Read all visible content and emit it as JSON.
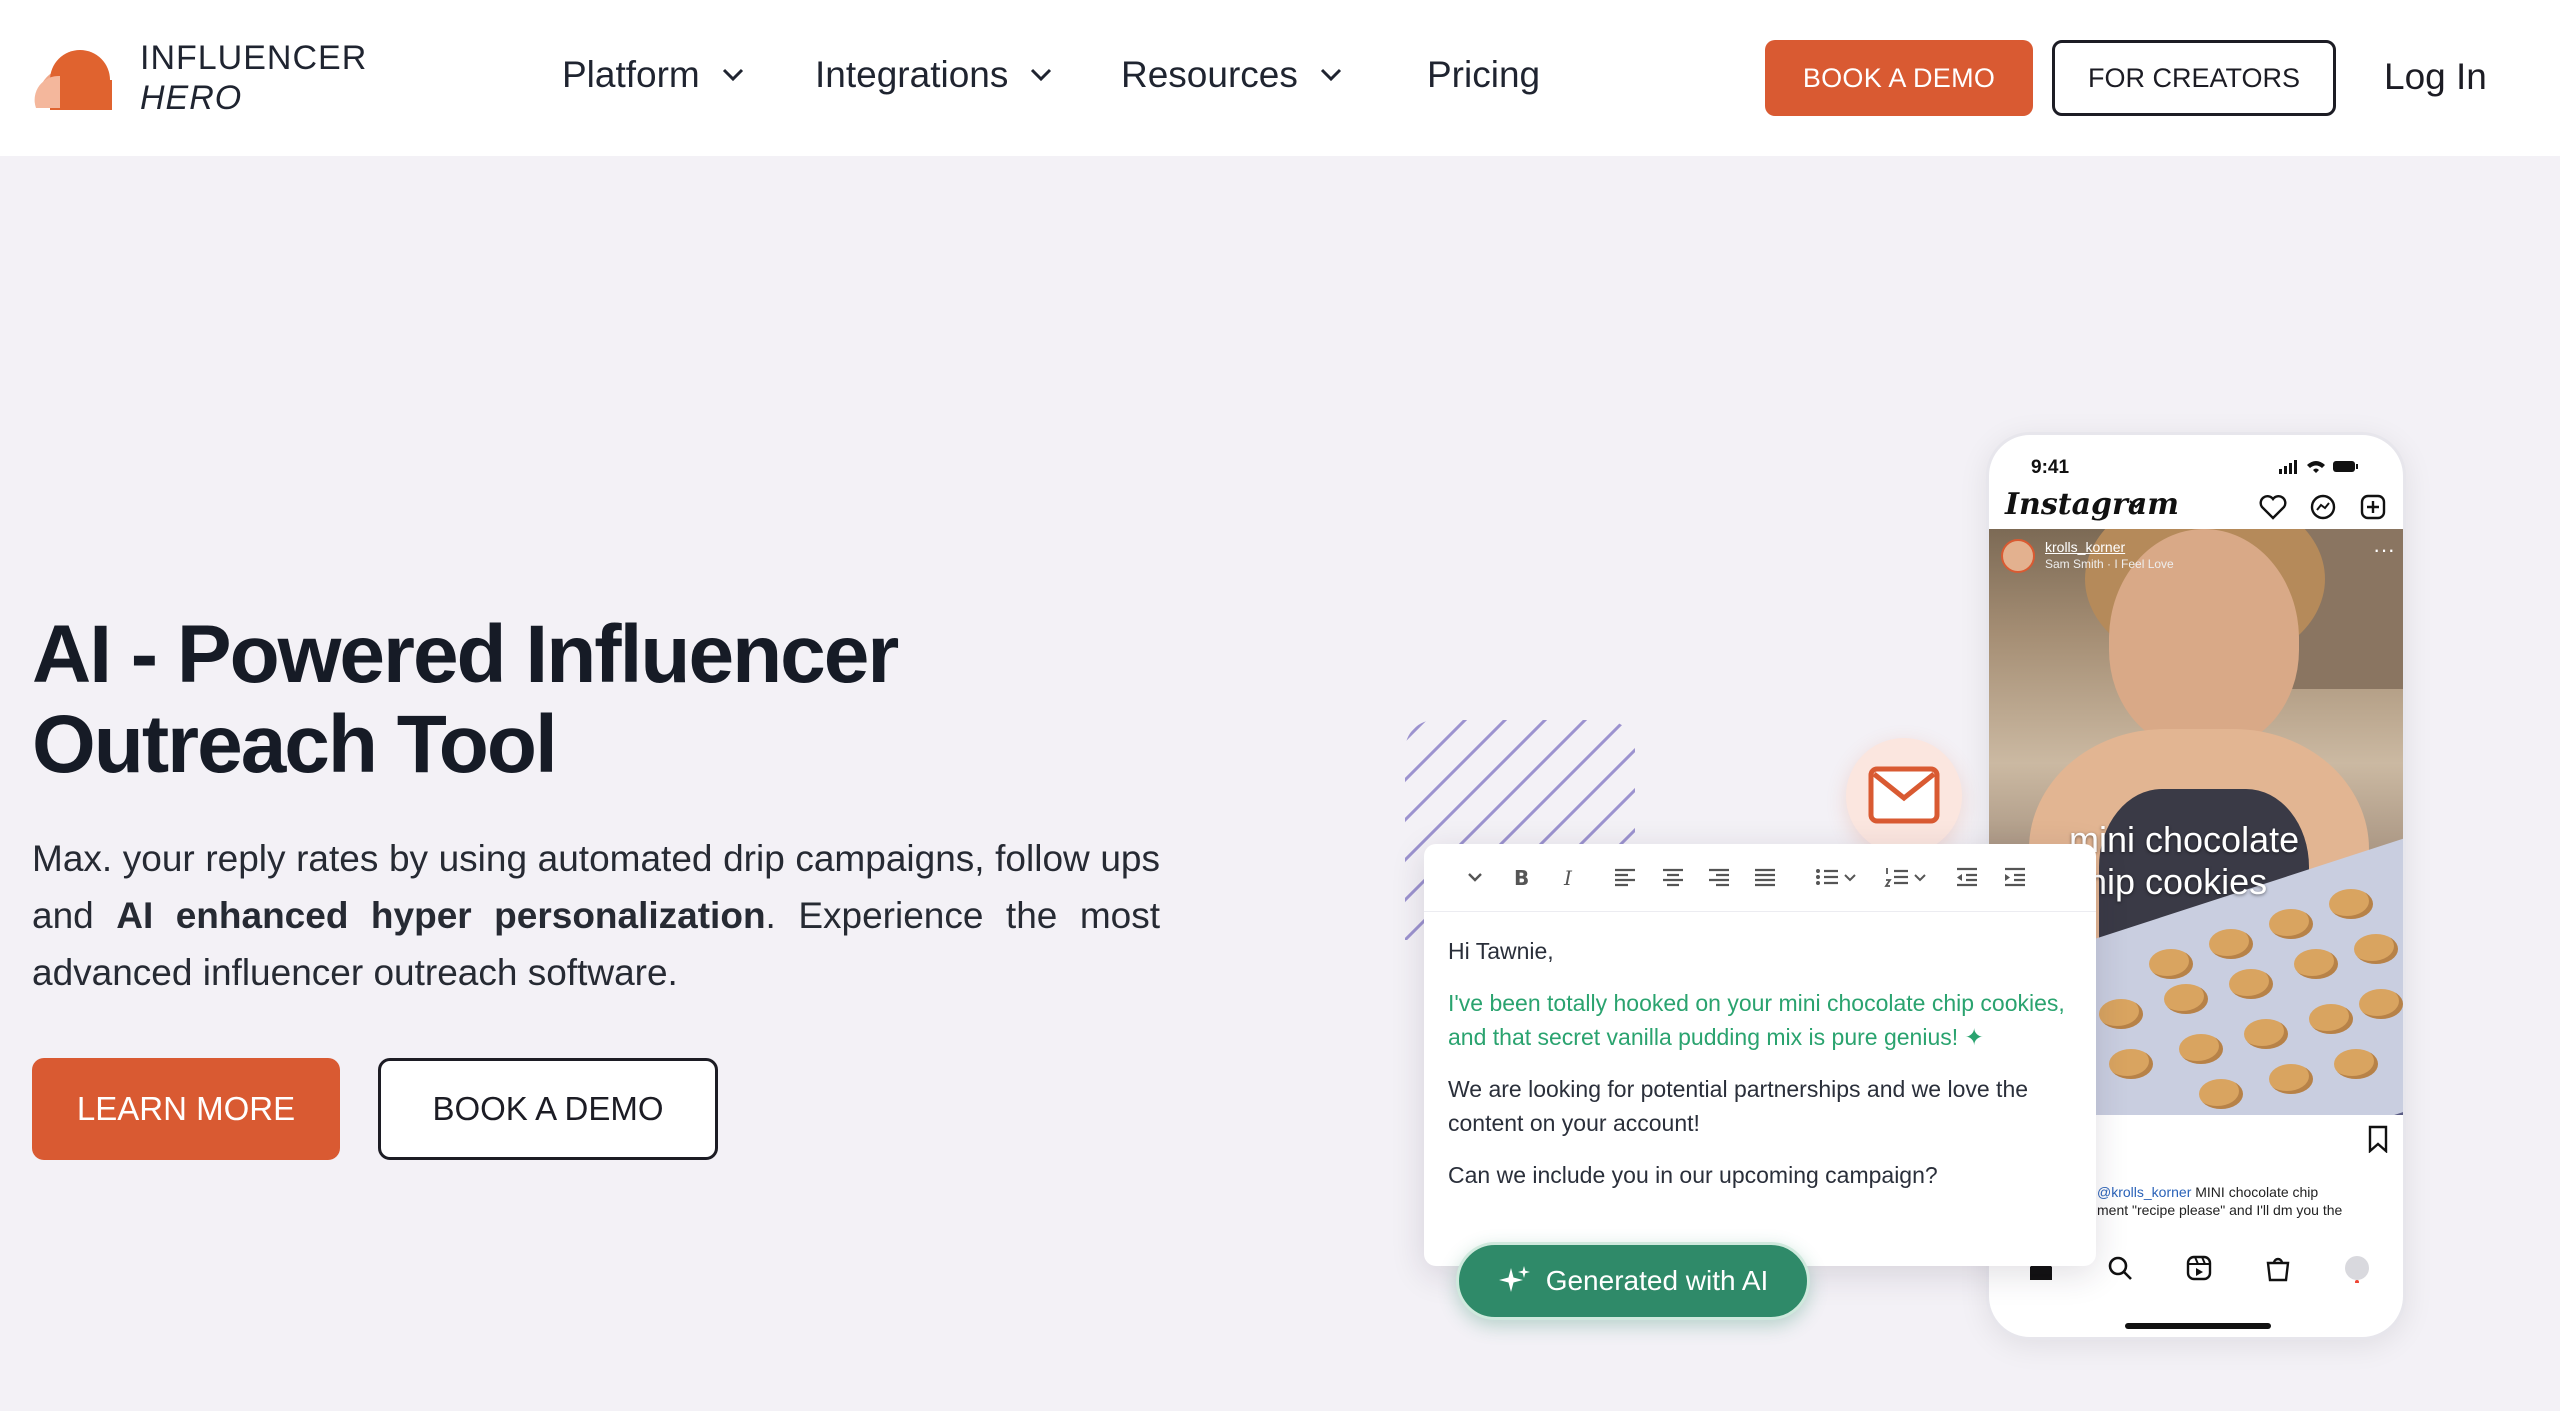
{
  "header": {
    "logo_line1": "INFLUENCER",
    "logo_line2": "HERO",
    "nav": [
      {
        "label": "Platform",
        "has_dropdown": true
      },
      {
        "label": "Integrations",
        "has_dropdown": true
      },
      {
        "label": "Resources",
        "has_dropdown": true
      },
      {
        "label": "Pricing",
        "has_dropdown": false
      }
    ],
    "book_demo_label": "BOOK A DEMO",
    "for_creators_label": "FOR CREATORS",
    "login_label": "Log In"
  },
  "hero": {
    "title_line1": "AI - Powered Influencer",
    "title_line2": "Outreach Tool",
    "desc_part1": "Max. your reply rates by using automated drip campaigns, follow ups and ",
    "desc_bold": "AI enhanced hyper personalization",
    "desc_part2": ". Experience the most advanced influencer outreach software.",
    "learn_more_label": "LEARN MORE",
    "book_demo_label": "BOOK A DEMO"
  },
  "phone": {
    "time": "9:41",
    "app_name": "Instagram",
    "username": "krolls_korner",
    "song": "Sam Smith · I Feel Love",
    "caption_overlay_line1": "mini chocolate",
    "caption_overlay_line2": "chip cookies",
    "caption_handle": "@krolls_korner",
    "caption_text1": " MINI chocolate chip",
    "caption_text2": "ment \"recipe please\" and I'll dm you the"
  },
  "email": {
    "greeting": "Hi Tawnie,",
    "ai_text": "I've been totally hooked on your mini chocolate chip cookies, and that secret vanilla pudding mix is pure genius!",
    "line2": "We are looking for potential partnerships and we love the content on your account!",
    "line3": "Can we include you in our upcoming campaign?"
  },
  "ai_badge": {
    "label": "Generated with AI"
  },
  "colors": {
    "brand_orange": "#d95a32",
    "ai_green": "#2f8a69",
    "background": "#f3f1f6"
  }
}
